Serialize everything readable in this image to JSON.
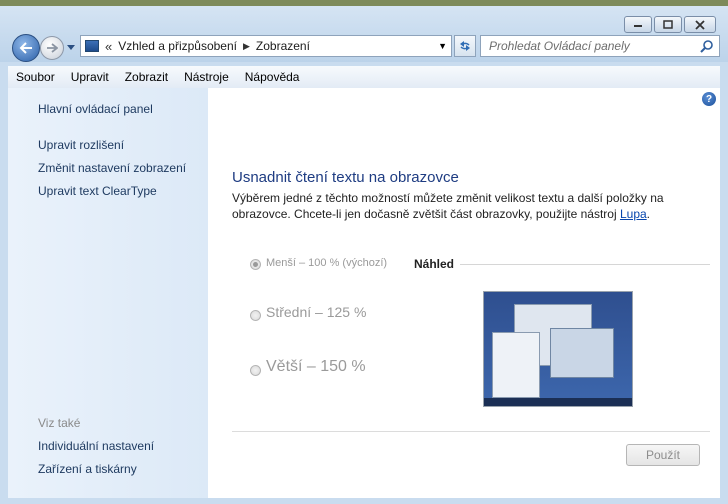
{
  "window": {
    "caption": {
      "minimize_icon": "minimize-icon",
      "maximize_icon": "maximize-icon",
      "close_icon": "close-icon"
    }
  },
  "nav": {
    "breadcrumb_sep": "«",
    "breadcrumb": [
      "Vzhled a přizpůsobení",
      "Zobrazení"
    ],
    "search_placeholder": "Prohledat Ovládací panely"
  },
  "menu": [
    "Soubor",
    "Upravit",
    "Zobrazit",
    "Nástroje",
    "Nápověda"
  ],
  "sidebar": {
    "home": "Hlavní ovládací panel",
    "links": [
      "Upravit rozlišení",
      "Změnit nastavení zobrazení",
      "Upravit text ClearType"
    ],
    "see_also_title": "Viz také",
    "see_also": [
      "Individuální nastavení",
      "Zařízení a tiskárny"
    ]
  },
  "main": {
    "help": "?",
    "title": "Usnadnit čtení textu na obrazovce",
    "desc_text": "Výběrem jedné z těchto možností můžete změnit velikost textu a další položky na obrazovce. Chcete-li jen dočasně zvětšit část obrazovky, použijte nástroj ",
    "desc_link": "Lupa",
    "desc_end": ".",
    "options": [
      {
        "label": "Menší – 100 % (výchozí)",
        "checked": true
      },
      {
        "label": "Střední – 125 %",
        "checked": false
      },
      {
        "label": "Větší – 150 %",
        "checked": false
      }
    ],
    "preview_label": "Náhled",
    "apply_label": "Použít"
  }
}
